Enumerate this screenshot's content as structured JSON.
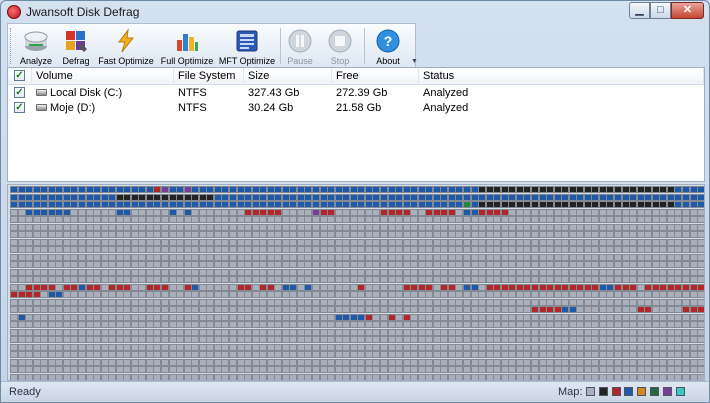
{
  "window": {
    "title": "Jwansoft Disk Defrag"
  },
  "toolbar": {
    "buttons": [
      {
        "label": "Analyze",
        "icon": "analyze-icon"
      },
      {
        "label": "Defrag",
        "icon": "defrag-icon"
      },
      {
        "label": "Fast Optimize",
        "icon": "fast-optimize-icon"
      },
      {
        "label": "Full Optimize",
        "icon": "full-optimize-icon"
      },
      {
        "label": "MFT Optimize",
        "icon": "mft-optimize-icon"
      },
      {
        "label": "Pause",
        "icon": "pause-icon",
        "disabled": true
      },
      {
        "label": "Stop",
        "icon": "stop-icon",
        "disabled": true
      },
      {
        "label": "About",
        "icon": "about-icon"
      }
    ]
  },
  "columns": [
    "Volume",
    "File System",
    "Size",
    "Free",
    "Status"
  ],
  "drives": [
    {
      "volume": "Local Disk (C:)",
      "fs": "NTFS",
      "size": "327.43 Gb",
      "free": "272.39 Gb",
      "status": "Analyzed",
      "checked": true
    },
    {
      "volume": "Moje (D:)",
      "fs": "NTFS",
      "size": "30.24 Gb",
      "free": "21.58 Gb",
      "status": "Analyzed",
      "checked": true
    }
  ],
  "status": {
    "text": "Ready",
    "map_label": "Map:"
  },
  "colors": {
    "free": "#a9b0bc",
    "used": "#1f5aa8",
    "fragmented": "#b3262a",
    "system": "#232323",
    "mft": "#7a3d9a",
    "directory": "#1f8a3a",
    "legend": [
      "#a9b0bc",
      "#232323",
      "#b3262a",
      "#1f5aa8",
      "#d4891f",
      "#1f6b3a",
      "#7a3d9a",
      "#37c7c2"
    ]
  }
}
